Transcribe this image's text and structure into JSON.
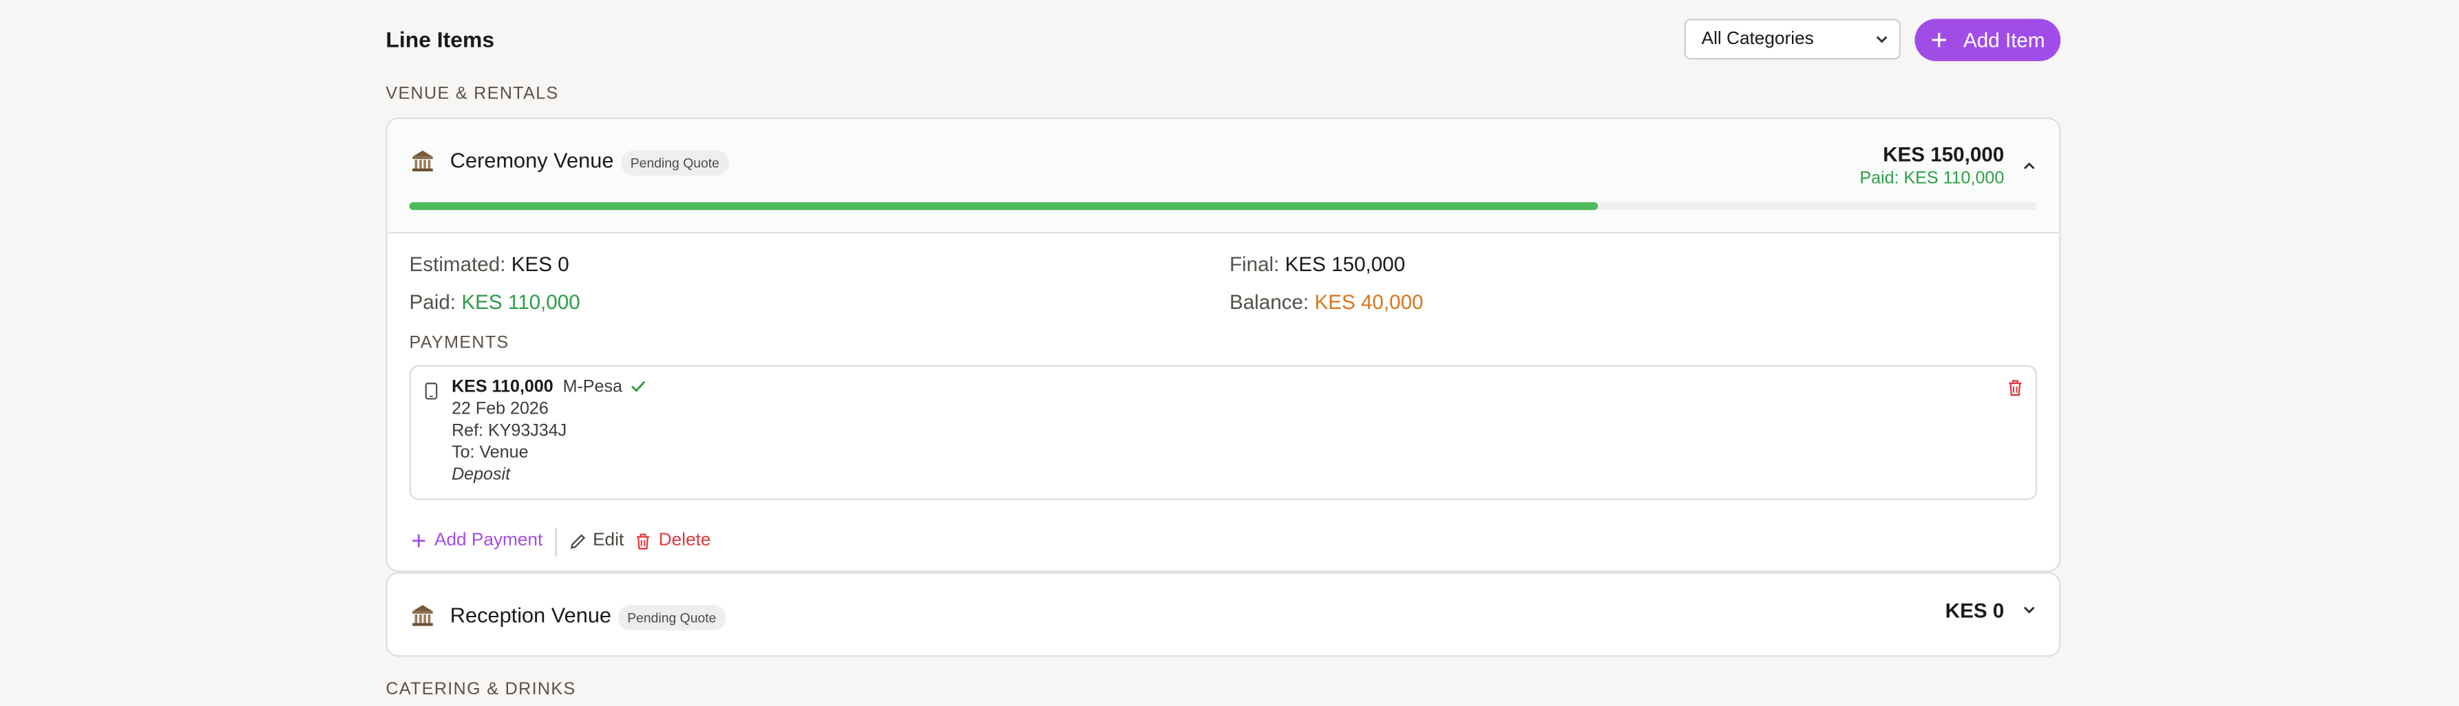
{
  "header": {
    "title": "Line Items",
    "category_filter": "All Categories",
    "add_item_label": "Add Item"
  },
  "sections": [
    {
      "label": "VENUE & RENTALS",
      "items": [
        {
          "icon": "classical-building-icon",
          "name": "Ceremony Venue",
          "badge": "Pending Quote",
          "amount": "KES 150,000",
          "paid_summary": "Paid: KES 110,000",
          "paid_fraction": 0.73,
          "expanded": true,
          "details": {
            "estimated_label": "Estimated:",
            "estimated_value": "KES 0",
            "final_label": "Final:",
            "final_value": "KES 150,000",
            "paid_label": "Paid:",
            "paid_value": "KES 110,000",
            "balance_label": "Balance:",
            "balance_value": "KES 40,000"
          },
          "payments_title": "PAYMENTS",
          "payments": [
            {
              "icon": "mobile-phone-icon",
              "amount": "KES 110,000",
              "method": "M-Pesa",
              "status_icon": "check-icon",
              "date": "22 Feb 2026",
              "ref": "Ref: KY93J34J",
              "to": "To: Venue",
              "note": "Deposit"
            }
          ],
          "actions": {
            "add_payment": "Add Payment",
            "edit": "Edit",
            "delete": "Delete"
          }
        },
        {
          "icon": "classical-building-icon",
          "name": "Reception Venue",
          "badge": "Pending Quote",
          "amount": "KES 0",
          "expanded": false
        }
      ]
    },
    {
      "label": "CATERING & DRINKS",
      "items": []
    }
  ],
  "colors": {
    "accent": "#a24ce8",
    "paid_green": "#2e9d46",
    "progress_green": "#4fba5a",
    "balance_orange": "#d8741c",
    "danger_red": "#e0393e"
  }
}
